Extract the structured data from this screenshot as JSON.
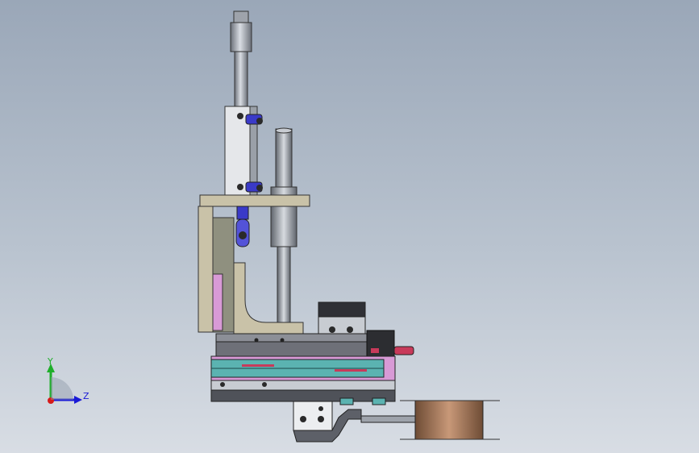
{
  "view": {
    "background_top": "#9aa7b8",
    "background_bottom": "#d8dde4"
  },
  "triad": {
    "y_label": "Y",
    "z_label": "Z",
    "y_color": "#1fae2a",
    "z_color": "#1a1ad6",
    "x_color": "#d61a1a"
  },
  "model": {
    "name_icon": "cad-assembly-side-view",
    "colors": {
      "frame": "#c9c2a8",
      "frame_dark": "#6e6a5c",
      "steel": "#b7bcc4",
      "steel_dark": "#5c6068",
      "pink": "#d89ad6",
      "teal": "#5bb3b1",
      "dark": "#2c2d31",
      "blue": "#3a3ac8",
      "red": "#c83a5a",
      "copper": "#a8785a"
    }
  }
}
